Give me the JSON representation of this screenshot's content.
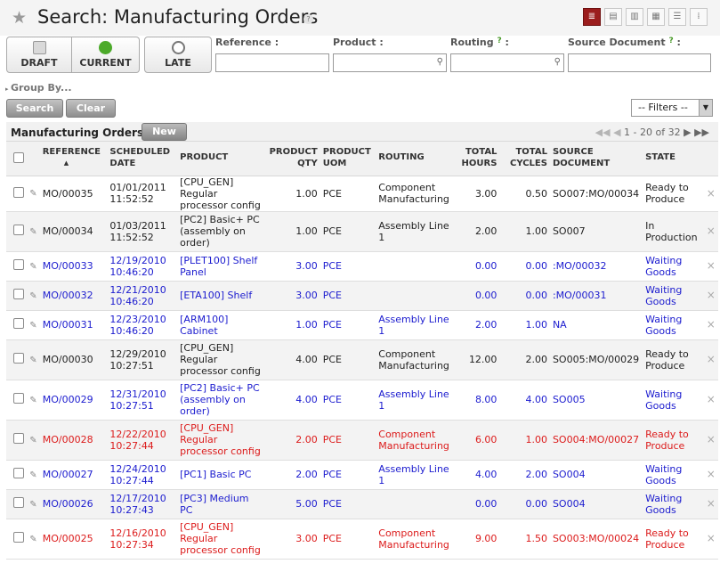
{
  "header": {
    "title": "Search: Manufacturing Orders",
    "help_label": "?"
  },
  "views": [
    "list-view-icon",
    "form-view-icon",
    "graph-view-icon",
    "calendar-view-icon",
    "gantt-view-icon",
    "kanban-view-icon"
  ],
  "filters": {
    "draft_label": "DRAFT",
    "current_label": "CURRENT",
    "late_label": "LATE",
    "reference_label": "Reference :",
    "reference_value": "",
    "product_label": "Product :",
    "product_value": "",
    "routing_label": "Routing",
    "routing_value": "",
    "source_label": "Source Document",
    "source_value": "",
    "help_q": "?",
    "colon": ":"
  },
  "groupby_label": "Group By...",
  "search_label": "Search",
  "clear_label": "Clear",
  "filters_select": {
    "selected": "-- Filters --"
  },
  "grid": {
    "title": "Manufacturing Orders",
    "new_label": "New",
    "pager_text": "1 - 20 of 32",
    "columns": {
      "reference": "REFERENCE",
      "date1": "SCHEDULED",
      "date2": "DATE",
      "product": "PRODUCT",
      "qty1": "PRODUCT",
      "qty2": "QTY",
      "uom1": "PRODUCT",
      "uom2": "UOM",
      "routing": "ROUTING",
      "hours1": "TOTAL",
      "hours2": "HOURS",
      "cycles1": "TOTAL",
      "cycles2": "CYCLES",
      "source1": "SOURCE",
      "source2": "DOCUMENT",
      "state": "STATE"
    },
    "rows": [
      {
        "ref": "MO/00035",
        "date": [
          "01/01/2011",
          "11:52:52"
        ],
        "product": [
          "[CPU_GEN]",
          "Regular",
          "processor config"
        ],
        "qty": "1.00",
        "uom": "PCE",
        "routing": [
          "Component",
          "Manufacturing"
        ],
        "hours": "3.00",
        "cycles": "0.50",
        "source": "SO007:MO/00034",
        "state": [
          "Ready to",
          "Produce"
        ],
        "color": "black"
      },
      {
        "ref": "MO/00034",
        "date": [
          "01/03/2011",
          "11:52:52"
        ],
        "product": [
          "[PC2] Basic+ PC",
          "(assembly on",
          "order)"
        ],
        "qty": "1.00",
        "uom": "PCE",
        "routing": [
          "Assembly Line 1"
        ],
        "hours": "2.00",
        "cycles": "1.00",
        "source": "SO007",
        "state": [
          "In",
          "Production"
        ],
        "color": "black"
      },
      {
        "ref": "MO/00033",
        "date": [
          "12/19/2010",
          "10:46:20"
        ],
        "product": [
          "[PLET100] Shelf",
          "Panel"
        ],
        "qty": "3.00",
        "uom": "PCE",
        "routing": [],
        "hours": "0.00",
        "cycles": "0.00",
        "source": ":MO/00032",
        "state": [
          "Waiting",
          "Goods"
        ],
        "color": "blue"
      },
      {
        "ref": "MO/00032",
        "date": [
          "12/21/2010",
          "10:46:20"
        ],
        "product": [
          "[ETA100] Shelf"
        ],
        "qty": "3.00",
        "uom": "PCE",
        "routing": [],
        "hours": "0.00",
        "cycles": "0.00",
        "source": ":MO/00031",
        "state": [
          "Waiting",
          "Goods"
        ],
        "color": "blue"
      },
      {
        "ref": "MO/00031",
        "date": [
          "12/23/2010",
          "10:46:20"
        ],
        "product": [
          "[ARM100]",
          "Cabinet"
        ],
        "qty": "1.00",
        "uom": "PCE",
        "routing": [
          "Assembly Line 1"
        ],
        "hours": "2.00",
        "cycles": "1.00",
        "source": "NA",
        "state": [
          "Waiting",
          "Goods"
        ],
        "color": "blue"
      },
      {
        "ref": "MO/00030",
        "date": [
          "12/29/2010",
          "10:27:51"
        ],
        "product": [
          "[CPU_GEN]",
          "Regular",
          "processor config"
        ],
        "qty": "4.00",
        "uom": "PCE",
        "routing": [
          "Component",
          "Manufacturing"
        ],
        "hours": "12.00",
        "cycles": "2.00",
        "source": "SO005:MO/00029",
        "state": [
          "Ready to",
          "Produce"
        ],
        "color": "black"
      },
      {
        "ref": "MO/00029",
        "date": [
          "12/31/2010",
          "10:27:51"
        ],
        "product": [
          "[PC2] Basic+ PC",
          "(assembly on",
          "order)"
        ],
        "qty": "4.00",
        "uom": "PCE",
        "routing": [
          "Assembly Line 1"
        ],
        "hours": "8.00",
        "cycles": "4.00",
        "source": "SO005",
        "state": [
          "Waiting",
          "Goods"
        ],
        "color": "blue"
      },
      {
        "ref": "MO/00028",
        "date": [
          "12/22/2010",
          "10:27:44"
        ],
        "product": [
          "[CPU_GEN]",
          "Regular",
          "processor config"
        ],
        "qty": "2.00",
        "uom": "PCE",
        "routing": [
          "Component",
          "Manufacturing"
        ],
        "hours": "6.00",
        "cycles": "1.00",
        "source": "SO004:MO/00027",
        "state": [
          "Ready to",
          "Produce"
        ],
        "color": "red"
      },
      {
        "ref": "MO/00027",
        "date": [
          "12/24/2010",
          "10:27:44"
        ],
        "product": [
          "[PC1] Basic PC"
        ],
        "qty": "2.00",
        "uom": "PCE",
        "routing": [
          "Assembly Line 1"
        ],
        "hours": "4.00",
        "cycles": "2.00",
        "source": "SO004",
        "state": [
          "Waiting",
          "Goods"
        ],
        "color": "blue"
      },
      {
        "ref": "MO/00026",
        "date": [
          "12/17/2010",
          "10:27:43"
        ],
        "product": [
          "[PC3] Medium",
          "PC"
        ],
        "qty": "5.00",
        "uom": "PCE",
        "routing": [],
        "hours": "0.00",
        "cycles": "0.00",
        "source": "SO004",
        "state": [
          "Waiting",
          "Goods"
        ],
        "color": "blue"
      },
      {
        "ref": "MO/00025",
        "date": [
          "12/16/2010",
          "10:27:34"
        ],
        "product": [
          "[CPU_GEN]",
          "Regular",
          "processor config"
        ],
        "qty": "3.00",
        "uom": "PCE",
        "routing": [
          "Component",
          "Manufacturing"
        ],
        "hours": "9.00",
        "cycles": "1.50",
        "source": "SO003:MO/00024",
        "state": [
          "Ready to",
          "Produce"
        ],
        "color": "red"
      }
    ]
  }
}
